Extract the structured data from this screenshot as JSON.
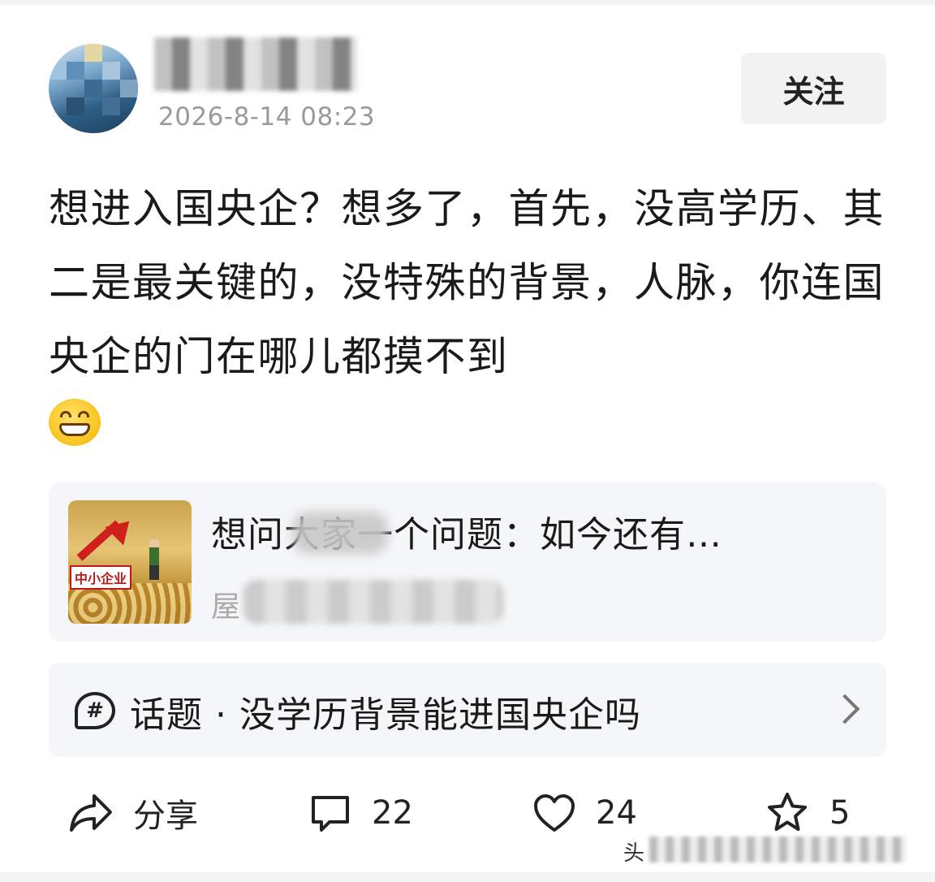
{
  "header": {
    "author_name": "",
    "timestamp": "2026-8-14 08:23",
    "follow_label": "关注"
  },
  "post": {
    "text": "想进入国央企？想多了，首先，没高学历、其二是最关键的，没特殊的背景，人脉，你连国央企的门在哪儿都摸不到",
    "emoji": "grinning-face-with-smiling-eyes"
  },
  "article": {
    "thumbnail_label": "中小企业",
    "title": "想问大家一个问题：如今还有…",
    "source": "屋"
  },
  "topic": {
    "text": "话题 · 没学历背景能进国央企吗",
    "icon": "hashtag-bubble-icon"
  },
  "actions": {
    "share_label": "分享",
    "comment_count": "22",
    "like_count": "24",
    "favorite_count": "5"
  },
  "watermark": {
    "text": "头"
  },
  "colors": {
    "page_bg": "#f4f4f4",
    "card_bg": "#ffffff",
    "secondary_text": "#9a9a9a",
    "panel_bg": "#f5f6f8"
  }
}
